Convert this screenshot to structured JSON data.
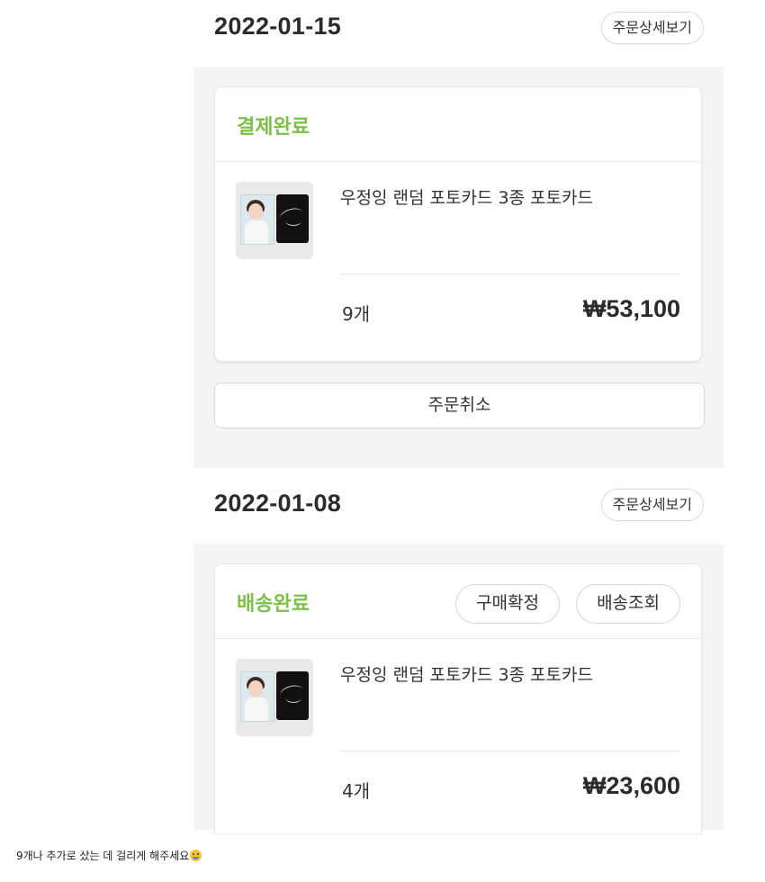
{
  "orders": [
    {
      "date": "2022-01-15",
      "detail_label": "주문상세보기",
      "status": "결제완료",
      "product_name": "우정잉 랜덤 포토카드 3종 포토카드",
      "quantity": "9개",
      "price": "₩53,100",
      "cancel_label": "주문취소"
    },
    {
      "date": "2022-01-08",
      "detail_label": "주문상세보기",
      "status": "배송완료",
      "confirm_label": "구매확정",
      "track_label": "배송조회",
      "product_name": "우정잉 랜덤 포토카드 3종 포토카드",
      "quantity": "4개",
      "price": "₩23,600"
    }
  ],
  "caption": "9개나 추가로 샀는 데 걸리게 해주세요",
  "caption_icon": "crying-face-emoji-icon",
  "colors": {
    "status_green": "#7cc04b",
    "panel_bg": "#f4f4f4"
  }
}
